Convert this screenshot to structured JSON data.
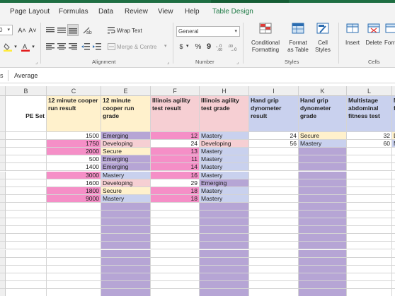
{
  "menu": {
    "tabs": [
      "Page Layout",
      "Formulas",
      "Data",
      "Review",
      "View",
      "Help",
      "Table Design"
    ],
    "active_tab": "Table Design"
  },
  "ribbon": {
    "font": {
      "size_fragment": "0",
      "grow_label": "A˄",
      "shrink_label": "A˅",
      "font_color_label": "A",
      "fill_color_label": "◇"
    },
    "alignment": {
      "label": "Alignment",
      "wrap_text": "Wrap Text",
      "merge_center": "Merge & Centre"
    },
    "number": {
      "label": "Number",
      "format_value": "General",
      "currency": "$",
      "percent": "%",
      "comma": "9",
      "inc_decimal": "⁰₀",
      "dec_decimal": "₀₀"
    },
    "styles": {
      "label": "Styles",
      "conditional_formatting": "Conditional Formatting",
      "format_as_table": "Format as Table",
      "cell_styles": "Cell Styles"
    },
    "cells": {
      "label": "Cells",
      "insert": "Insert",
      "delete": "Delete",
      "format": "Forr"
    }
  },
  "formula_bar": {
    "name_box": "s",
    "content": "Average"
  },
  "colors": {
    "pink": "#f58fc7",
    "light_pink": "#f6cfd3",
    "purple": "#b6a5d5",
    "lavender": "#c9d1ee",
    "peach": "#fff1cc",
    "header_bg": "#efefef",
    "green_accent": "#1e7a45"
  },
  "columns": {
    "B": "B",
    "C": "C",
    "E": "E",
    "F": "F",
    "H": "H",
    "I": "I",
    "K": "K",
    "L": "L",
    "M": "M"
  },
  "headers": {
    "B": "PE Set",
    "C": "12 minute cooper run result",
    "E": "12 minute cooper run grade",
    "F": "Illinois agility test result",
    "H": "Illinois agility test grade",
    "I": "Hand grip dynometer result",
    "K": "Hand grip dynometer grade",
    "L": "Multistage abdominal fitness test",
    "M": "Mu ab fitn"
  },
  "rows": [
    {
      "C": "1500",
      "E": "Emerging",
      "F": "12",
      "H": "Mastery",
      "I": "24",
      "K": "Secure",
      "L": "32",
      "M": "De"
    },
    {
      "C": "1750",
      "E": "Developing",
      "F": "24",
      "H": "Developing",
      "I": "56",
      "K": "Mastery",
      "L": "60",
      "M": "Ma"
    },
    {
      "C": "2000",
      "E": "Secure",
      "F": "13",
      "H": "Mastery"
    },
    {
      "C": "500",
      "E": "Emerging",
      "F": "11",
      "H": "Mastery"
    },
    {
      "C": "1400",
      "E": "Emerging",
      "F": "14",
      "H": "Mastery"
    },
    {
      "C": "3000",
      "E": "Mastery",
      "F": "16",
      "H": "Mastery"
    },
    {
      "C": "1600",
      "E": "Developing",
      "F": "29",
      "H": "Emerging"
    },
    {
      "C": "1800",
      "E": "Secure",
      "F": "18",
      "H": "Mastery"
    },
    {
      "C": "9000",
      "E": "Mastery",
      "F": "18",
      "H": "Mastery"
    }
  ]
}
